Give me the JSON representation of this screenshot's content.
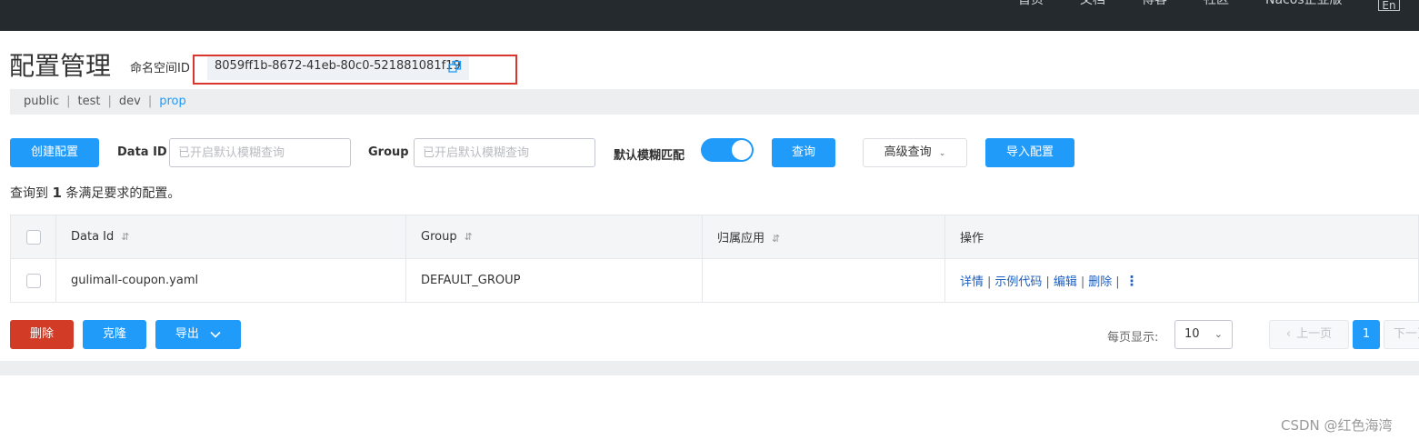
{
  "topnav": {
    "items": [
      "首页",
      "文档",
      "博客",
      "社区",
      "Nacos企业版"
    ],
    "lang_button": "En"
  },
  "header": {
    "title": "配置管理",
    "namespace_label": "命名空间ID",
    "namespace_id": "8059ff1b-8672-41eb-80c0-521881081f19",
    "copy_icon": "copy-icon",
    "highlight_color": "#d9362e"
  },
  "namespaces": {
    "items": [
      {
        "label": "public",
        "active": false
      },
      {
        "label": "test",
        "active": false
      },
      {
        "label": "dev",
        "active": false
      },
      {
        "label": "prop",
        "active": true
      }
    ],
    "separator": "|"
  },
  "toolbar": {
    "create_label": "创建配置",
    "dataid_label": "Data ID",
    "dataid_placeholder": "已开启默认模糊查询",
    "group_label": "Group",
    "group_placeholder": "已开启默认模糊查询",
    "fuzzy_label": "默认模糊匹配",
    "fuzzy_enabled": true,
    "query_label": "查询",
    "advanced_label": "高级查询",
    "import_label": "导入配置"
  },
  "result": {
    "prefix": "查询到",
    "count": "1",
    "suffix": "条满足要求的配置。"
  },
  "table": {
    "headers": {
      "data_id": "Data Id",
      "group": "Group",
      "app": "归属应用",
      "ops": "操作"
    },
    "sort_icon": "⇵",
    "rows": [
      {
        "data_id": "gulimall-coupon.yaml",
        "group": "DEFAULT_GROUP",
        "app": "",
        "ops": [
          "详情",
          "示例代码",
          "编辑",
          "删除"
        ],
        "more": "⋮"
      }
    ]
  },
  "bottom_actions": {
    "delete_label": "删除",
    "clone_label": "克隆",
    "export_label": "导出"
  },
  "pagination": {
    "page_size_label": "每页显示:",
    "page_size": "10",
    "prev_label": "上一页",
    "current_page": "1",
    "next_label": "下一页"
  },
  "watermark": "CSDN @红色海湾",
  "colors": {
    "primary": "#209bfa",
    "danger": "#d23c26",
    "link": "#1e5fbd",
    "topbar": "#252a2f"
  }
}
